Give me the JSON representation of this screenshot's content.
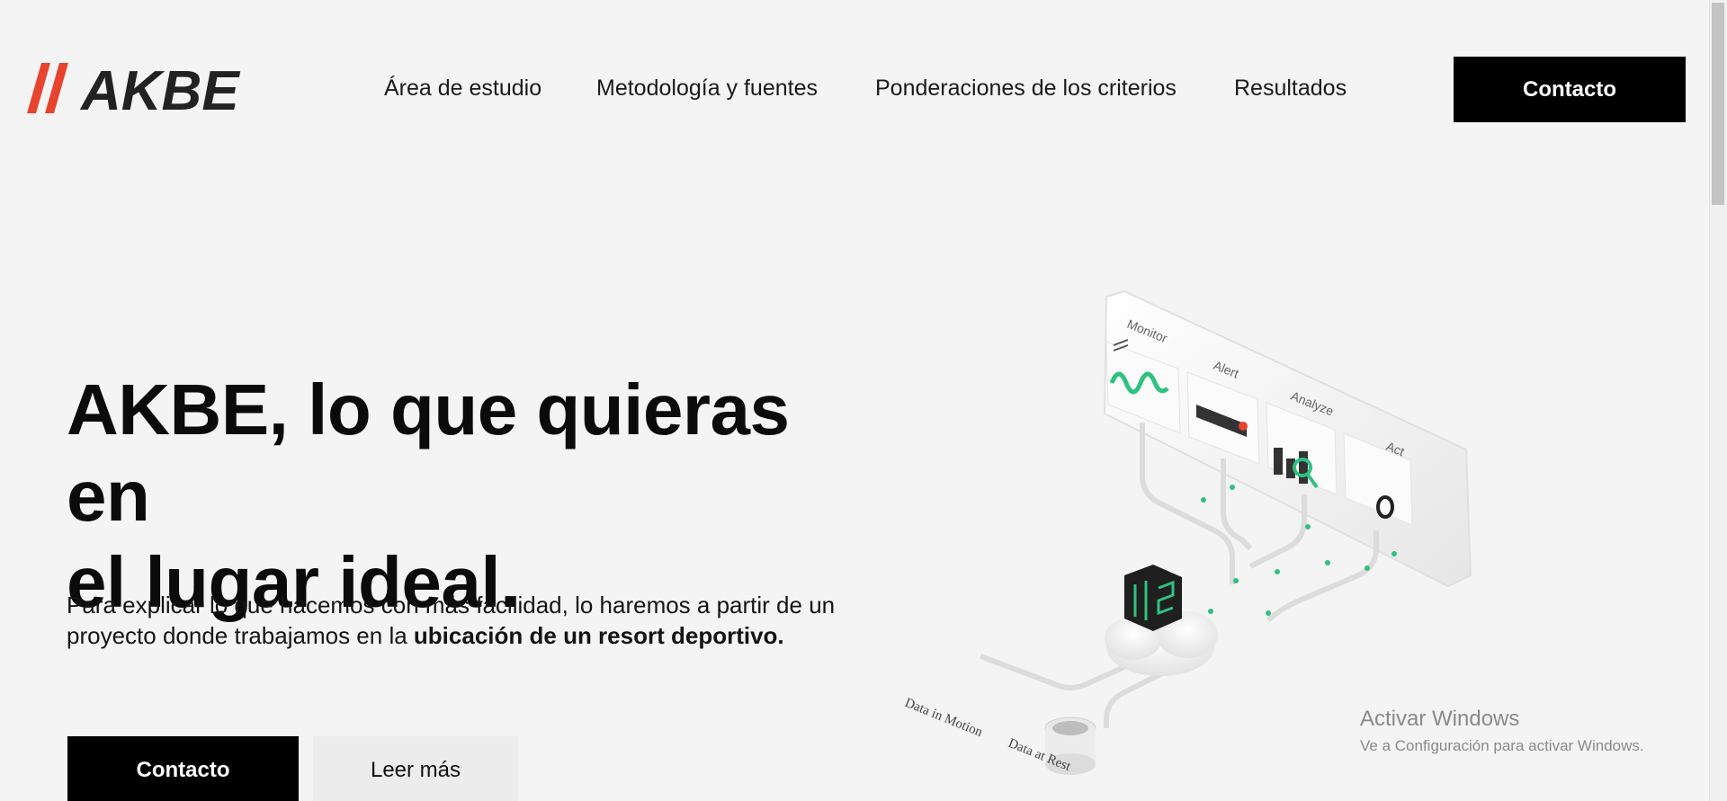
{
  "brand": {
    "name": "AKBE",
    "accent_color": "#e8432e"
  },
  "nav": {
    "items": [
      {
        "label": "Área de estudio"
      },
      {
        "label": "Metodología y fuentes"
      },
      {
        "label": "Ponderaciones de los criterios"
      },
      {
        "label": "Resultados"
      }
    ],
    "contact_label": "Contacto"
  },
  "hero": {
    "title_line1": "AKBE, lo que quieras en",
    "title_line2": "el lugar ideal.",
    "desc_part1": "Para explicar lo que hacemos con más facilidad, lo haremos a partir de un proyecto donde trabajamos en la ",
    "desc_bold": "ubicación de un resort deportivo.",
    "primary_button": "Contacto",
    "secondary_button": "Leer más"
  },
  "illustration": {
    "labels": {
      "monitor": "Monitor",
      "alert": "Alert",
      "analyze": "Analyze",
      "act": "Act",
      "data_in_motion": "Data in Motion",
      "data_at_rest": "Data at Rest"
    },
    "accent_color": "#2fc17f"
  },
  "watermark": {
    "title": "Activar Windows",
    "subtitle": "Ve a Configuración para activar Windows."
  }
}
